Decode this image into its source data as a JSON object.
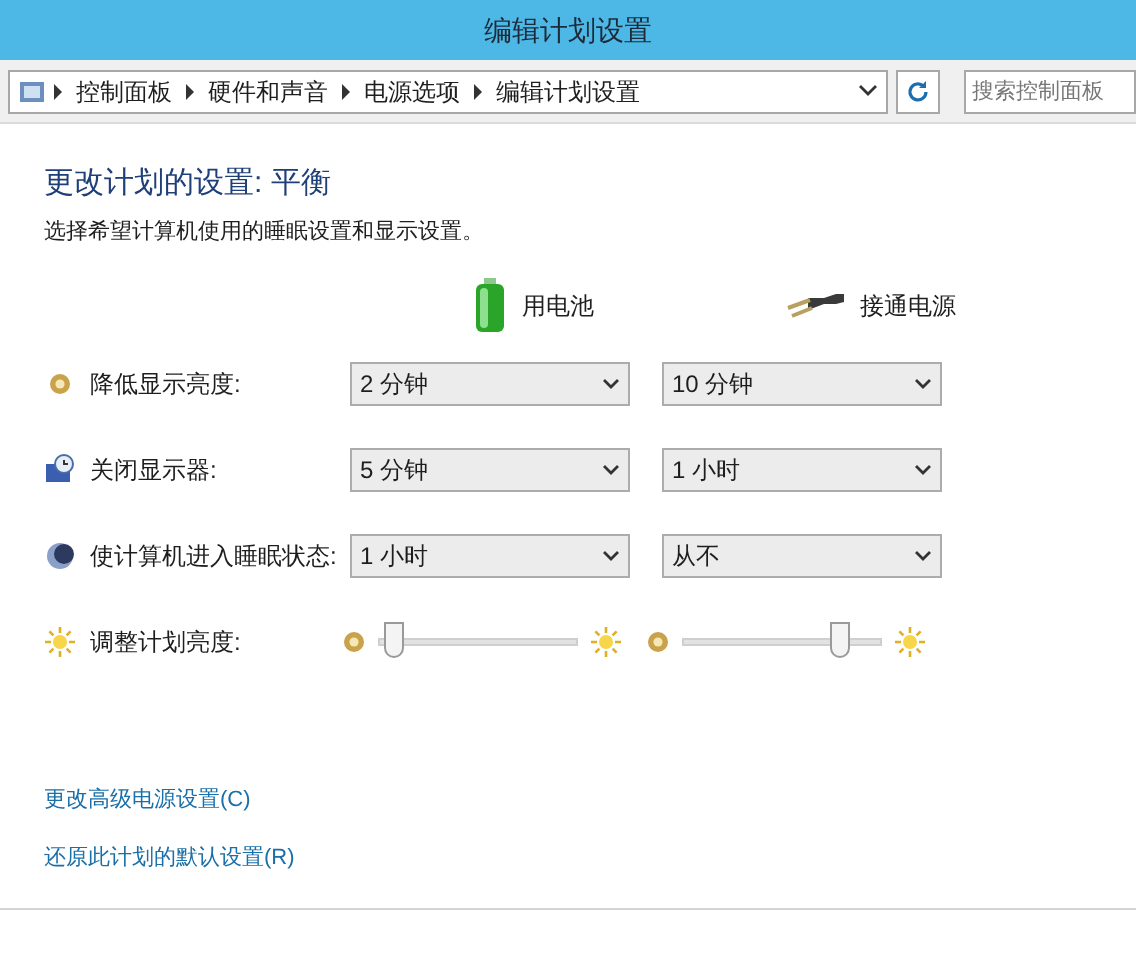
{
  "window": {
    "title": "编辑计划设置"
  },
  "address_bar": {
    "breadcrumbs": [
      "控制面板",
      "硬件和声音",
      "电源选项",
      "编辑计划设置"
    ],
    "search_placeholder": "搜索控制面板"
  },
  "heading": "更改计划的设置: 平衡",
  "subtitle": "选择希望计算机使用的睡眠设置和显示设置。",
  "columns": [
    {
      "kind": "battery",
      "label": "用电池"
    },
    {
      "kind": "plug",
      "label": "接通电源"
    }
  ],
  "settings": [
    {
      "kind": "dropdown",
      "label": "降低显示亮度:",
      "values": [
        "2 分钟",
        "10 分钟"
      ]
    },
    {
      "kind": "dropdown",
      "label": "关闭显示器:",
      "values": [
        "5 分钟",
        "1 小时"
      ]
    },
    {
      "kind": "dropdown",
      "label": "使计算机进入睡眠状态:",
      "values": [
        "1 小时",
        "从不"
      ]
    },
    {
      "kind": "slider",
      "label": "调整计划亮度:",
      "sliders": [
        {
          "level": 0.07
        },
        {
          "level": 0.8
        }
      ]
    }
  ],
  "links": [
    "更改高级电源设置(C)",
    "还原此计划的默认设置(R)"
  ]
}
